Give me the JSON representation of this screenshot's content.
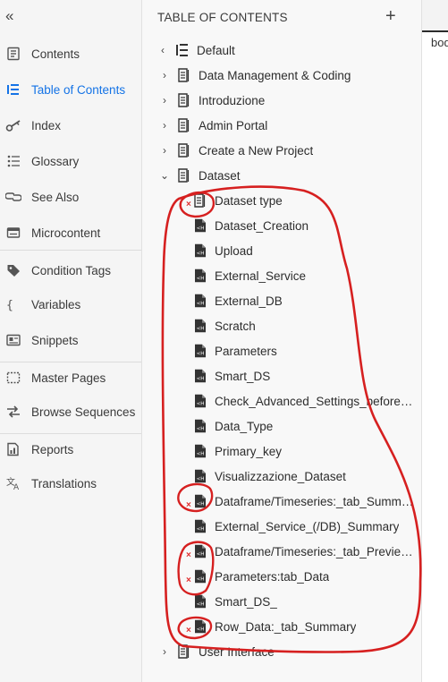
{
  "leftnav": {
    "items": [
      {
        "label": "Contents",
        "icon": "contents-icon"
      },
      {
        "label": "Table of Contents",
        "icon": "toc-icon",
        "active": true
      },
      {
        "label": "Index",
        "icon": "key-icon"
      },
      {
        "label": "Glossary",
        "icon": "glossary-list-icon"
      },
      {
        "label": "See Also",
        "icon": "link-icon"
      },
      {
        "label": "Microcontent",
        "icon": "microcontent-icon"
      },
      {
        "label": "Condition Tags",
        "icon": "tag-icon"
      },
      {
        "label": "Variables",
        "icon": "braces-icon"
      },
      {
        "label": "Snippets",
        "icon": "snippet-icon"
      },
      {
        "label": "Master Pages",
        "icon": "master-page-icon"
      },
      {
        "label": "Browse Sequences",
        "icon": "arrows-icon"
      },
      {
        "label": "Reports",
        "icon": "report-icon"
      },
      {
        "label": "Translations",
        "icon": "translate-icon"
      }
    ],
    "active_color": "#1473e6"
  },
  "panel": {
    "title": "TABLE OF CONTENTS",
    "add_symbol": "+",
    "root": {
      "label": "Default"
    },
    "tree": [
      {
        "label": "Data Management & Coding",
        "expanded": false
      },
      {
        "label": "Introduzione",
        "expanded": false
      },
      {
        "label": "Admin Portal",
        "expanded": false
      },
      {
        "label": "Create a New Project",
        "expanded": false
      },
      {
        "label": "Dataset",
        "expanded": true,
        "children": [
          {
            "label": "Dataset type",
            "broken": true
          },
          {
            "label": "Dataset_Creation",
            "broken": false
          },
          {
            "label": "Upload",
            "broken": false
          },
          {
            "label": "External_Service",
            "broken": false
          },
          {
            "label": "External_DB",
            "broken": false
          },
          {
            "label": "Scratch",
            "broken": false
          },
          {
            "label": "Parameters",
            "broken": false
          },
          {
            "label": "Smart_DS",
            "broken": false
          },
          {
            "label": "Check_Advanced_Settings_before_I...",
            "broken": false
          },
          {
            "label": "Data_Type",
            "broken": false
          },
          {
            "label": "Primary_key",
            "broken": false
          },
          {
            "label": "Visualizzazione_Dataset",
            "broken": false
          },
          {
            "label": "Dataframe/Timeseries:_tab_Summar...",
            "broken": true
          },
          {
            "label": "External_Service_(/DB)_Summary",
            "broken": false
          },
          {
            "label": "Dataframe/Timeseries:_tab_Preview...",
            "broken": true
          },
          {
            "label": "Parameters:tab_Data",
            "broken": true
          },
          {
            "label": "Smart_DS_",
            "broken": false
          },
          {
            "label": "Row_Data:_tab_Summary",
            "broken": true
          }
        ]
      },
      {
        "label": "User Interface",
        "expanded": false
      }
    ]
  },
  "right": {
    "text": "bod"
  },
  "colors": {
    "annotation": "#d62020",
    "broken_marker": "#e03030"
  }
}
